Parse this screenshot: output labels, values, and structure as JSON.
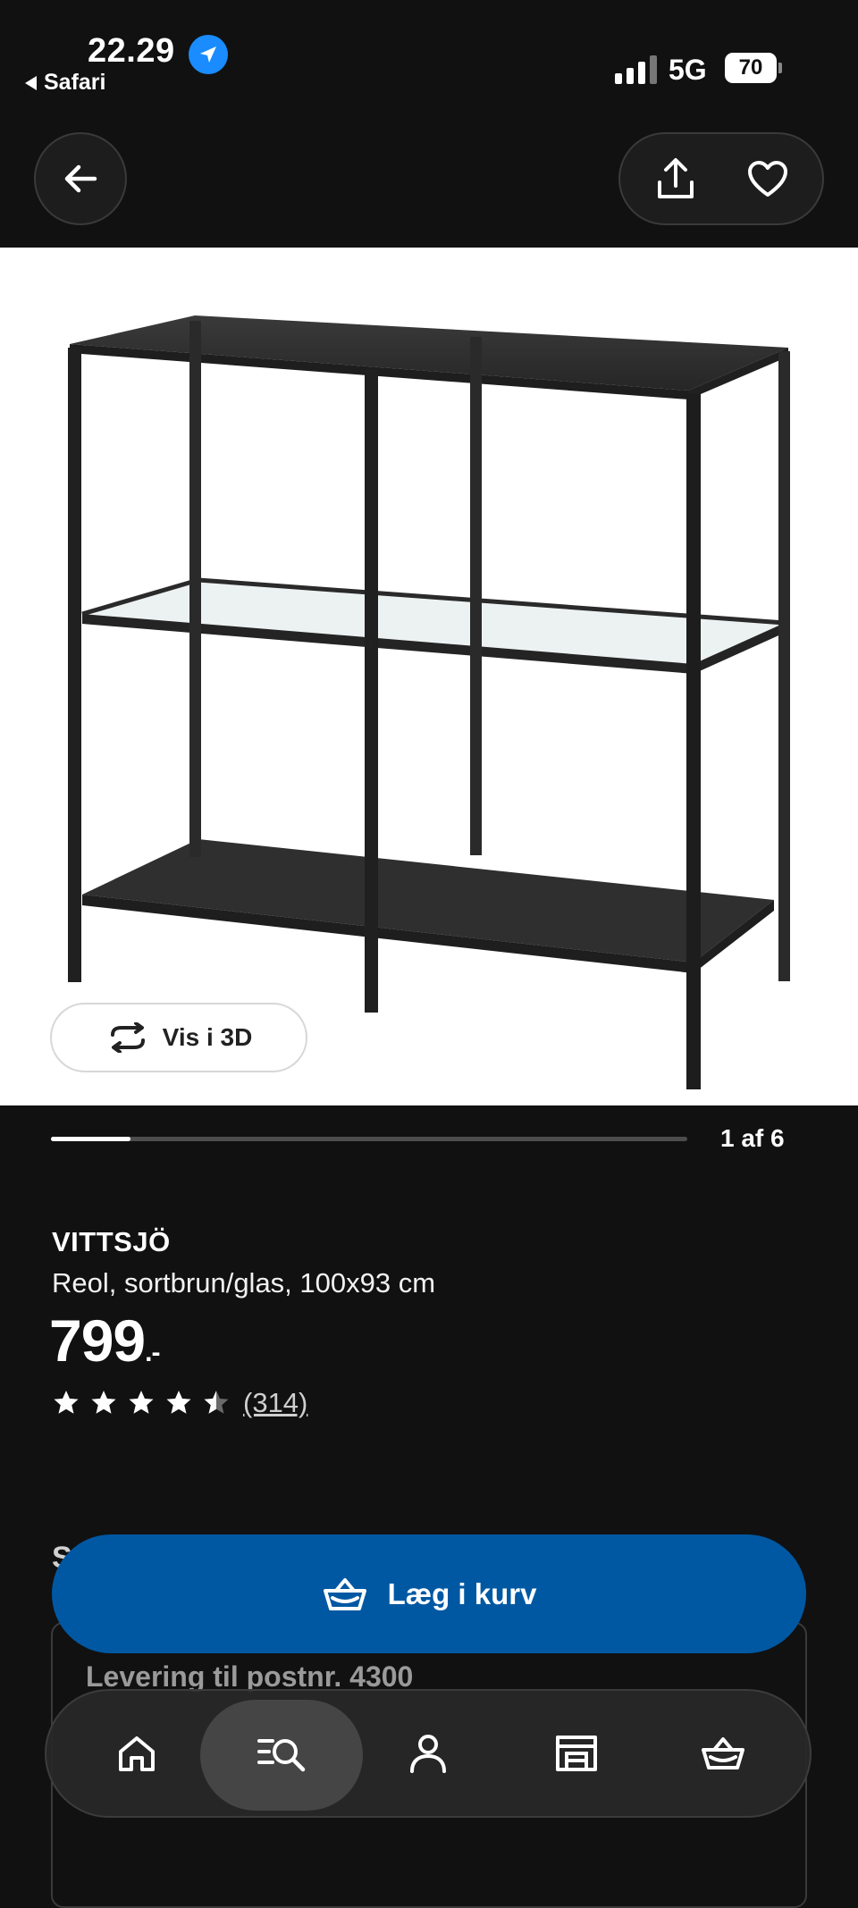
{
  "status_bar": {
    "time": "22.29",
    "back_app": "Safari",
    "network": "5G",
    "battery": "70"
  },
  "header": {
    "back_icon": "arrow-left-icon",
    "share_icon": "share-icon",
    "favorite_icon": "heart-icon"
  },
  "gallery": {
    "view_3d_label": "Vis i 3D",
    "counter": "1 af 6",
    "progress": 0.125
  },
  "product": {
    "brand": "VITTSJÖ",
    "description": "Reol, sortbrun/glas, 100x93 cm",
    "price": "799",
    "price_suffix": ".-",
    "rating": 4.5,
    "review_count": "(314)"
  },
  "section_behind": {
    "heading_initial": "S",
    "delivery_title": "Levering til postnr. 4300"
  },
  "cart": {
    "label": "Læg i kurv",
    "icon": "basket-icon",
    "color": "#0058a3"
  },
  "bottom_nav": {
    "items": [
      {
        "icon": "home-icon",
        "active": false
      },
      {
        "icon": "search-icon",
        "active": true
      },
      {
        "icon": "profile-icon",
        "active": false
      },
      {
        "icon": "store-icon",
        "active": false
      },
      {
        "icon": "basket-icon",
        "active": false
      }
    ]
  }
}
